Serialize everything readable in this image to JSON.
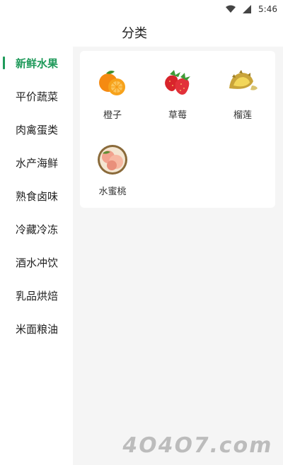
{
  "status_bar": {
    "time": "5:46",
    "icons": [
      "wifi-icon",
      "signal-icon"
    ]
  },
  "header": {
    "title": "分类"
  },
  "sidebar": {
    "items": [
      {
        "label": "新鲜水果",
        "active": true
      },
      {
        "label": "平价蔬菜",
        "active": false
      },
      {
        "label": "肉禽蛋类",
        "active": false
      },
      {
        "label": "水产海鲜",
        "active": false
      },
      {
        "label": "熟食卤味",
        "active": false
      },
      {
        "label": "冷藏冷冻",
        "active": false
      },
      {
        "label": "酒水冲饮",
        "active": false
      },
      {
        "label": "乳品烘焙",
        "active": false
      },
      {
        "label": "米面粮油",
        "active": false
      }
    ]
  },
  "products": [
    {
      "name": "橙子",
      "icon": "orange-image"
    },
    {
      "name": "草莓",
      "icon": "strawberry-image"
    },
    {
      "name": "榴莲",
      "icon": "durian-image"
    },
    {
      "name": "水蜜桃",
      "icon": "peach-image"
    }
  ],
  "colors": {
    "accent": "#1f9a5a",
    "content_bg": "#f5f5f5"
  },
  "watermark": {
    "text": "4O4O7.com"
  }
}
